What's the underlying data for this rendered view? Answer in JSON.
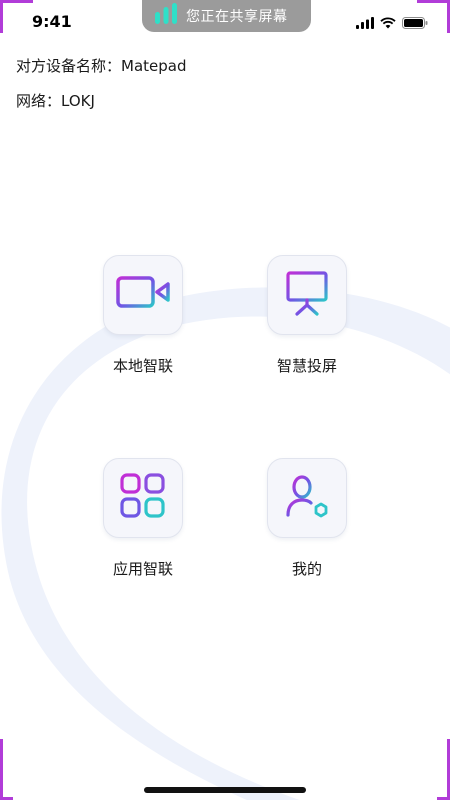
{
  "status_bar": {
    "time": "9:41",
    "share_label": "您正在共享屏幕",
    "icons": [
      "signal-icon",
      "wifi-icon",
      "battery-icon"
    ]
  },
  "info": {
    "device": "对方设备名称：Matepad",
    "network": "网络：LOKJ"
  },
  "tiles": [
    {
      "label": "本地智联",
      "icon": "video-camera-icon"
    },
    {
      "label": "智慧投屏",
      "icon": "presentation-board-icon"
    },
    {
      "label": "应用智联",
      "icon": "apps-grid-icon"
    },
    {
      "label": "我的",
      "icon": "user-profile-icon"
    }
  ],
  "colors": {
    "accent_purple": "#b13cd8",
    "accent_blue": "#4f6fe0",
    "accent_teal": "#2ec4c9",
    "share_pill": "#9b9b9b",
    "background_arc": "#eef2fb"
  }
}
